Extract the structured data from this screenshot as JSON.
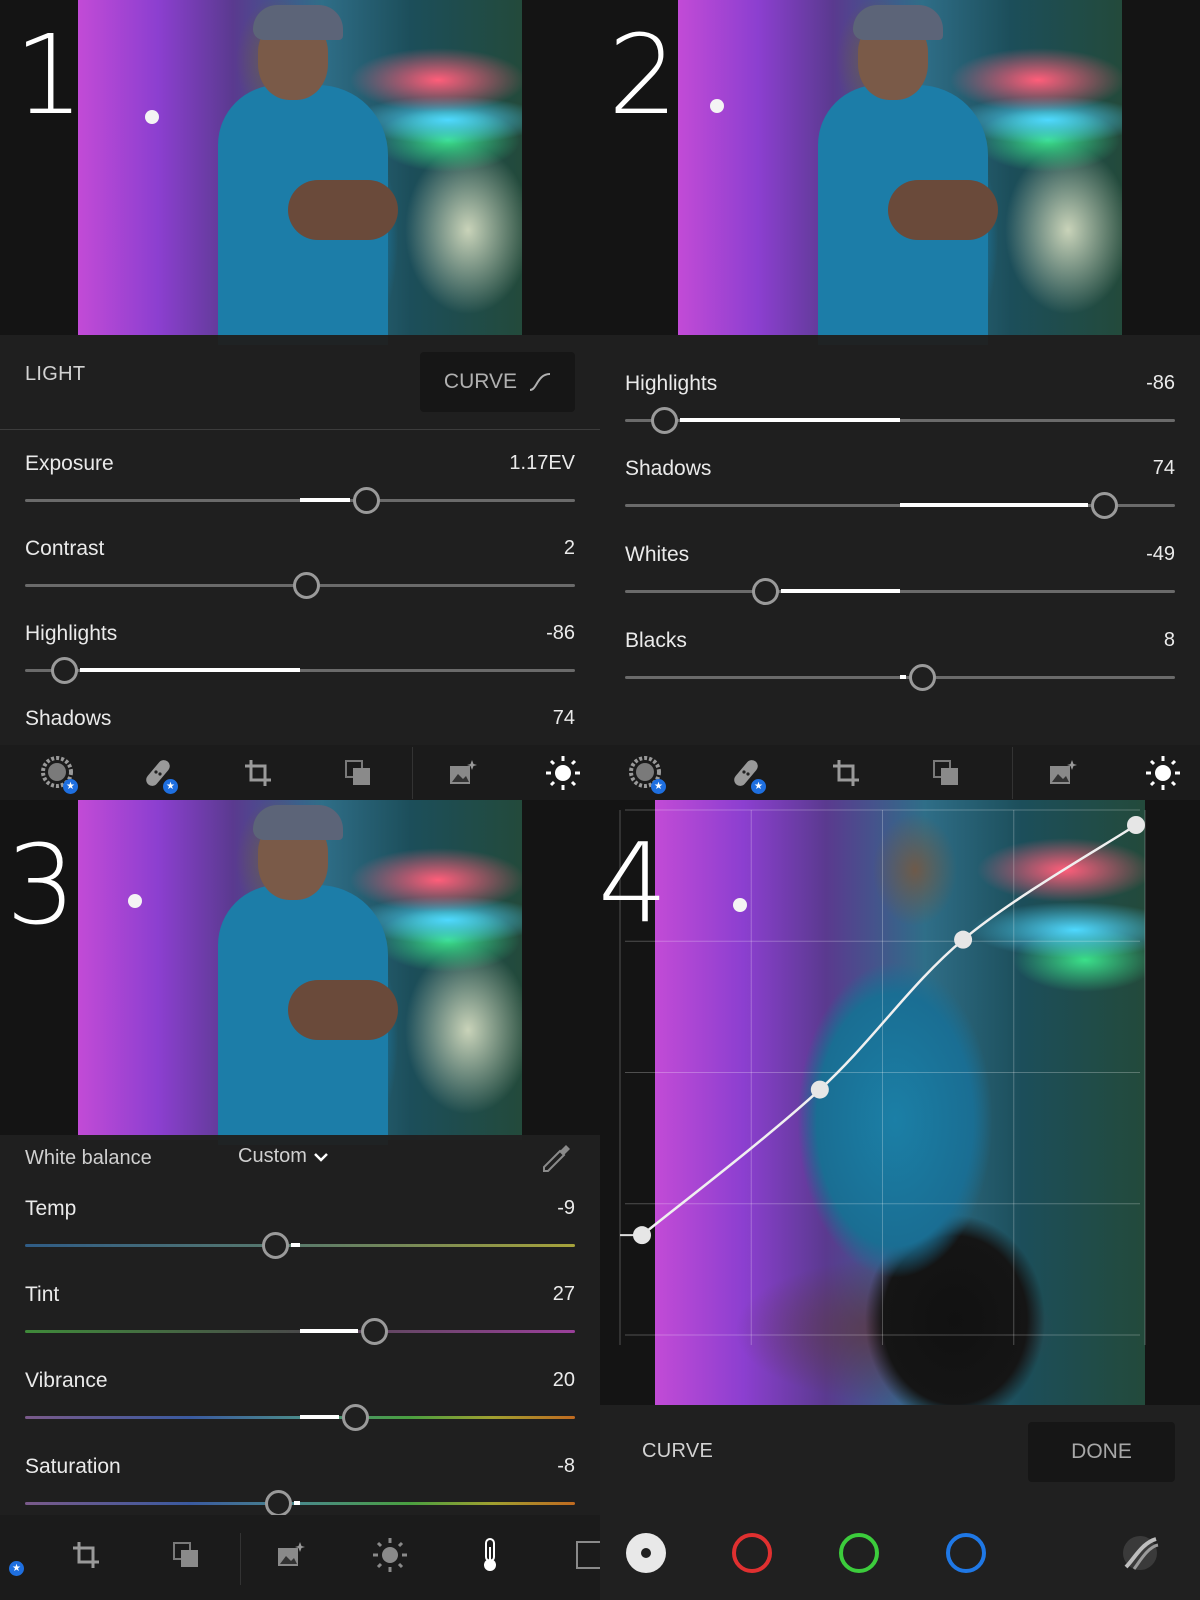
{
  "steps": [
    "1",
    "2",
    "3",
    "4"
  ],
  "light_panel": {
    "title": "LIGHT",
    "curve_button": "CURVE",
    "sliders": [
      {
        "label": "Exposure",
        "value": "1.17EV",
        "position": 0.62
      },
      {
        "label": "Contrast",
        "value": "2",
        "position": 0.51
      },
      {
        "label": "Highlights",
        "value": "-86",
        "position": 0.07
      },
      {
        "label": "Shadows",
        "value": "74",
        "position": 0.87
      }
    ]
  },
  "light_panel_scrolled": {
    "sliders": [
      {
        "label": "Highlights",
        "value": "-86",
        "position": 0.07
      },
      {
        "label": "Shadows",
        "value": "74",
        "position": 0.87
      },
      {
        "label": "Whites",
        "value": "-49",
        "position": 0.255
      },
      {
        "label": "Blacks",
        "value": "8",
        "position": 0.54
      }
    ]
  },
  "color_panel": {
    "white_balance_label": "White balance",
    "white_balance_value": "Custom",
    "sliders": [
      {
        "label": "Temp",
        "value": "-9",
        "position": 0.455
      },
      {
        "label": "Tint",
        "value": "27",
        "position": 0.635
      },
      {
        "label": "Vibrance",
        "value": "20",
        "position": 0.6
      },
      {
        "label": "Saturation",
        "value": "-8",
        "position": 0.46
      }
    ]
  },
  "toolbar": {
    "icons": [
      "selective-edit-icon",
      "healing-icon",
      "crop-icon",
      "versions-icon",
      "presets-icon",
      "light-icon"
    ],
    "bottom_icons": [
      "crop-icon",
      "versions-icon",
      "presets-icon",
      "light-icon",
      "color-temperature-icon",
      "effects-icon"
    ]
  },
  "curve_panel": {
    "title": "CURVE",
    "done_button": "DONE",
    "channels": [
      {
        "name": "luminance",
        "color": "#e8e8e8"
      },
      {
        "name": "red",
        "color": "#e03030"
      },
      {
        "name": "green",
        "color": "#3ccc3c"
      },
      {
        "name": "blue",
        "color": "#1f78e6"
      }
    ],
    "points": [
      [
        0.0,
        0.07
      ],
      [
        0.36,
        0.4
      ],
      [
        0.65,
        0.74
      ],
      [
        1.0,
        1.0
      ]
    ]
  },
  "colors": {
    "accent_blue": "#1e6fe0",
    "panel_bg": "#202020"
  }
}
